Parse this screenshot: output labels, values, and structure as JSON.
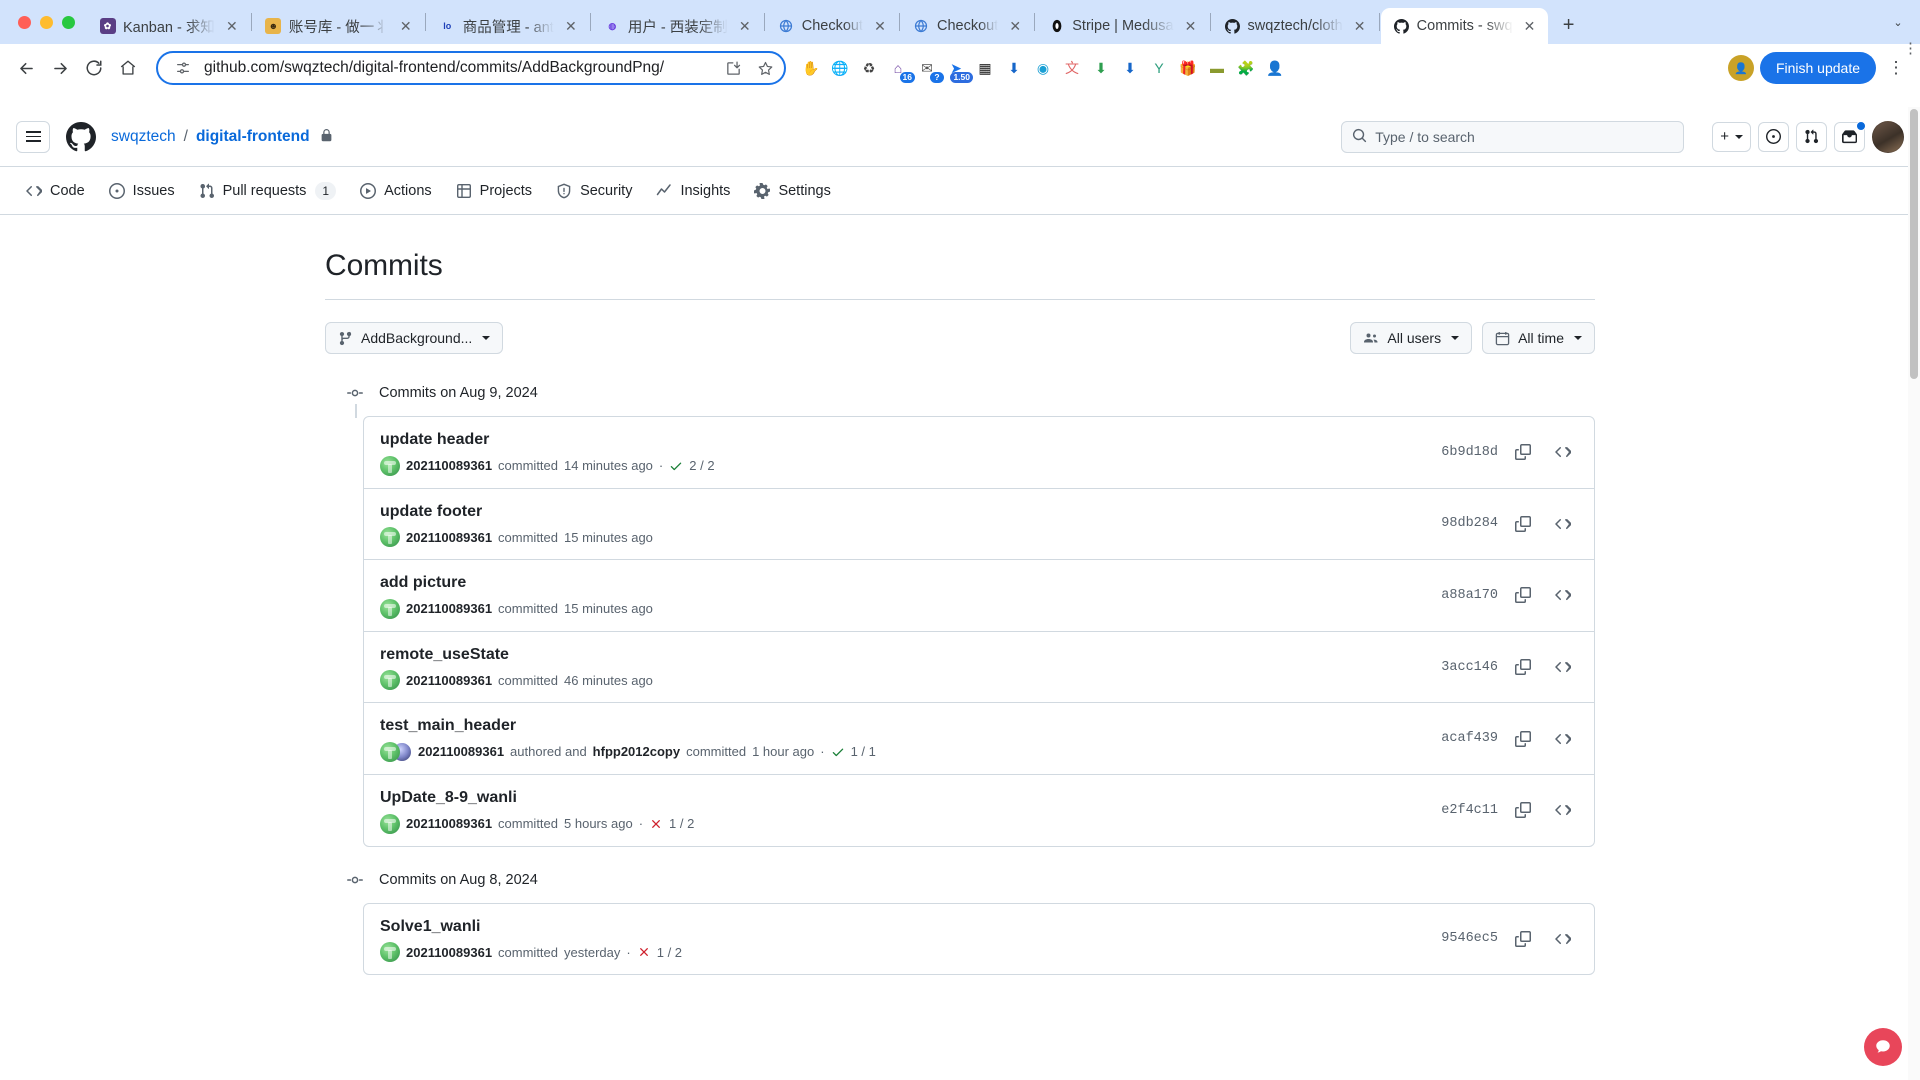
{
  "browser": {
    "tabs": [
      {
        "title": "Kanban - 求知",
        "favicon": "kanban-icon",
        "active": false
      },
      {
        "title": "账号库 - 做一丬",
        "favicon": "account-icon",
        "active": false
      },
      {
        "title": "商品管理 - ant",
        "favicon": "logo-icon",
        "active": false
      },
      {
        "title": "用户 - 西装定制",
        "favicon": "user-icon",
        "active": false
      },
      {
        "title": "Checkout",
        "favicon": "globe-icon",
        "active": false
      },
      {
        "title": "Checkout",
        "favicon": "globe-icon",
        "active": false
      },
      {
        "title": "Stripe | Medusa",
        "favicon": "stripe-icon",
        "active": false
      },
      {
        "title": "swqztech/cloth",
        "favicon": "github-icon",
        "active": false
      },
      {
        "title": "Commits - swq",
        "favicon": "github-icon",
        "active": true
      }
    ],
    "new_tab_label": "+",
    "tab_list_label": "⌄",
    "back_label": "←",
    "forward_label": "→",
    "reload_label": "⟳",
    "home_label": "⌂",
    "url": "github.com/swqztech/digital-frontend/commits/AddBackgroundPng/",
    "site_info_icon": "site-settings-icon",
    "install_icon": "install-app-icon",
    "bookmark_icon": "star-icon",
    "finish_update_label": "Finish update",
    "menu_label": "⋮",
    "extensions": [
      {
        "name": "adblock-extension",
        "glyph": "✋",
        "color": "#cf2a27",
        "badge": ""
      },
      {
        "name": "globe-extension",
        "glyph": "🌐",
        "color": "#3da33d",
        "badge": ""
      },
      {
        "name": "recycle-extension",
        "glyph": "♻",
        "color": "#444",
        "badge": ""
      },
      {
        "name": "home-extension",
        "glyph": "⌂",
        "color": "#6b3fa0",
        "badge": "16"
      },
      {
        "name": "mail-extension",
        "glyph": "✉",
        "color": "#555",
        "badge": "?"
      },
      {
        "name": "flag-extension",
        "glyph": "➤",
        "color": "#1a73e8",
        "badge": "1.50"
      },
      {
        "name": "qr-extension",
        "glyph": "▦",
        "color": "#222",
        "badge": ""
      },
      {
        "name": "download-extension",
        "glyph": "⬇",
        "color": "#1666c9",
        "badge": ""
      },
      {
        "name": "wave-extension",
        "glyph": "◉",
        "color": "#1a9fd4",
        "badge": ""
      },
      {
        "name": "translate-extension",
        "glyph": "文",
        "color": "#e06666",
        "badge": ""
      },
      {
        "name": "arrow-extension",
        "glyph": "⬇",
        "color": "#2e9e4f",
        "badge": ""
      },
      {
        "name": "blue-download-extension",
        "glyph": "⬇",
        "color": "#1666c9",
        "badge": ""
      },
      {
        "name": "y-extension",
        "glyph": "Y",
        "color": "#2e9e7e",
        "badge": ""
      },
      {
        "name": "gift-extension",
        "glyph": "🎁",
        "color": "#4e8f2f",
        "badge": ""
      },
      {
        "name": "tag-extension",
        "glyph": "▬",
        "color": "#8a9a2f",
        "badge": ""
      },
      {
        "name": "puzzle-extension",
        "glyph": "🧩",
        "color": "#5f6368",
        "badge": ""
      },
      {
        "name": "profile-extension",
        "glyph": "👤",
        "color": "#c9a227",
        "badge": ""
      }
    ]
  },
  "github": {
    "header": {
      "hamburger_label": "menu",
      "logo_label": "github-logo",
      "owner": "swqztech",
      "separator": "/",
      "repo": "digital-frontend",
      "visibility_icon": "lock-icon",
      "search_placeholder": "Type / to search",
      "create_label": "+",
      "issues_icon": "issue-opened-icon",
      "pulls_icon": "git-pull-request-icon",
      "inbox_icon": "inbox-icon",
      "avatar_label": "user-avatar"
    },
    "nav": [
      {
        "label": "Code",
        "icon": "code-icon",
        "count": ""
      },
      {
        "label": "Issues",
        "icon": "issue-opened-icon",
        "count": ""
      },
      {
        "label": "Pull requests",
        "icon": "git-pull-request-icon",
        "count": "1"
      },
      {
        "label": "Actions",
        "icon": "play-icon",
        "count": ""
      },
      {
        "label": "Projects",
        "icon": "table-icon",
        "count": ""
      },
      {
        "label": "Security",
        "icon": "shield-icon",
        "count": ""
      },
      {
        "label": "Insights",
        "icon": "graph-icon",
        "count": ""
      },
      {
        "label": "Settings",
        "icon": "gear-icon",
        "count": ""
      }
    ],
    "page_title": "Commits",
    "filters": {
      "branch_label": "AddBackground...",
      "branch_icon": "git-branch-icon",
      "users_label": "All users",
      "users_icon": "people-icon",
      "time_label": "All time",
      "time_icon": "calendar-icon"
    },
    "groups": [
      {
        "date_label": "Commits on Aug 9, 2024",
        "commits": [
          {
            "title": "update header",
            "author": "202110089361",
            "action": "committed",
            "time": "14 minutes ago",
            "coauthor": "",
            "status": "success",
            "checks": "2 / 2",
            "sha": "6b9d18d",
            "copy_icon": "copy-icon",
            "browse_icon": "code-icon"
          },
          {
            "title": "update footer",
            "author": "202110089361",
            "action": "committed",
            "time": "15 minutes ago",
            "coauthor": "",
            "status": "",
            "checks": "",
            "sha": "98db284",
            "copy_icon": "copy-icon",
            "browse_icon": "code-icon"
          },
          {
            "title": "add picture",
            "author": "202110089361",
            "action": "committed",
            "time": "15 minutes ago",
            "coauthor": "",
            "status": "",
            "checks": "",
            "sha": "a88a170",
            "copy_icon": "copy-icon",
            "browse_icon": "code-icon"
          },
          {
            "title": "remote_useState",
            "author": "202110089361",
            "action": "committed",
            "time": "46 minutes ago",
            "coauthor": "",
            "status": "",
            "checks": "",
            "sha": "3acc146",
            "copy_icon": "copy-icon",
            "browse_icon": "code-icon"
          },
          {
            "title": "test_main_header",
            "author": "202110089361",
            "action": "authored and",
            "time": "1 hour ago",
            "coauthor": "hfpp2012copy",
            "coauthor_action": "committed",
            "status": "success",
            "checks": "1 / 1",
            "sha": "acaf439",
            "copy_icon": "copy-icon",
            "browse_icon": "code-icon"
          },
          {
            "title": "UpDate_8-9_wanli",
            "author": "202110089361",
            "action": "committed",
            "time": "5 hours ago",
            "coauthor": "",
            "status": "failure",
            "checks": "1 / 2",
            "sha": "e2f4c11",
            "copy_icon": "copy-icon",
            "browse_icon": "code-icon"
          }
        ]
      },
      {
        "date_label": "Commits on Aug 8, 2024",
        "commits": [
          {
            "title": "Solve1_wanli",
            "author": "202110089361",
            "action": "committed",
            "time": "yesterday",
            "coauthor": "",
            "status": "failure",
            "checks": "1 / 2",
            "sha": "9546ec5",
            "copy_icon": "copy-icon",
            "browse_icon": "code-icon"
          }
        ]
      }
    ]
  },
  "colors": {
    "accent": "#0969da",
    "success": "#1a7f37",
    "danger": "#cf222e",
    "border": "#d1d9e0",
    "muted": "#59636e"
  }
}
